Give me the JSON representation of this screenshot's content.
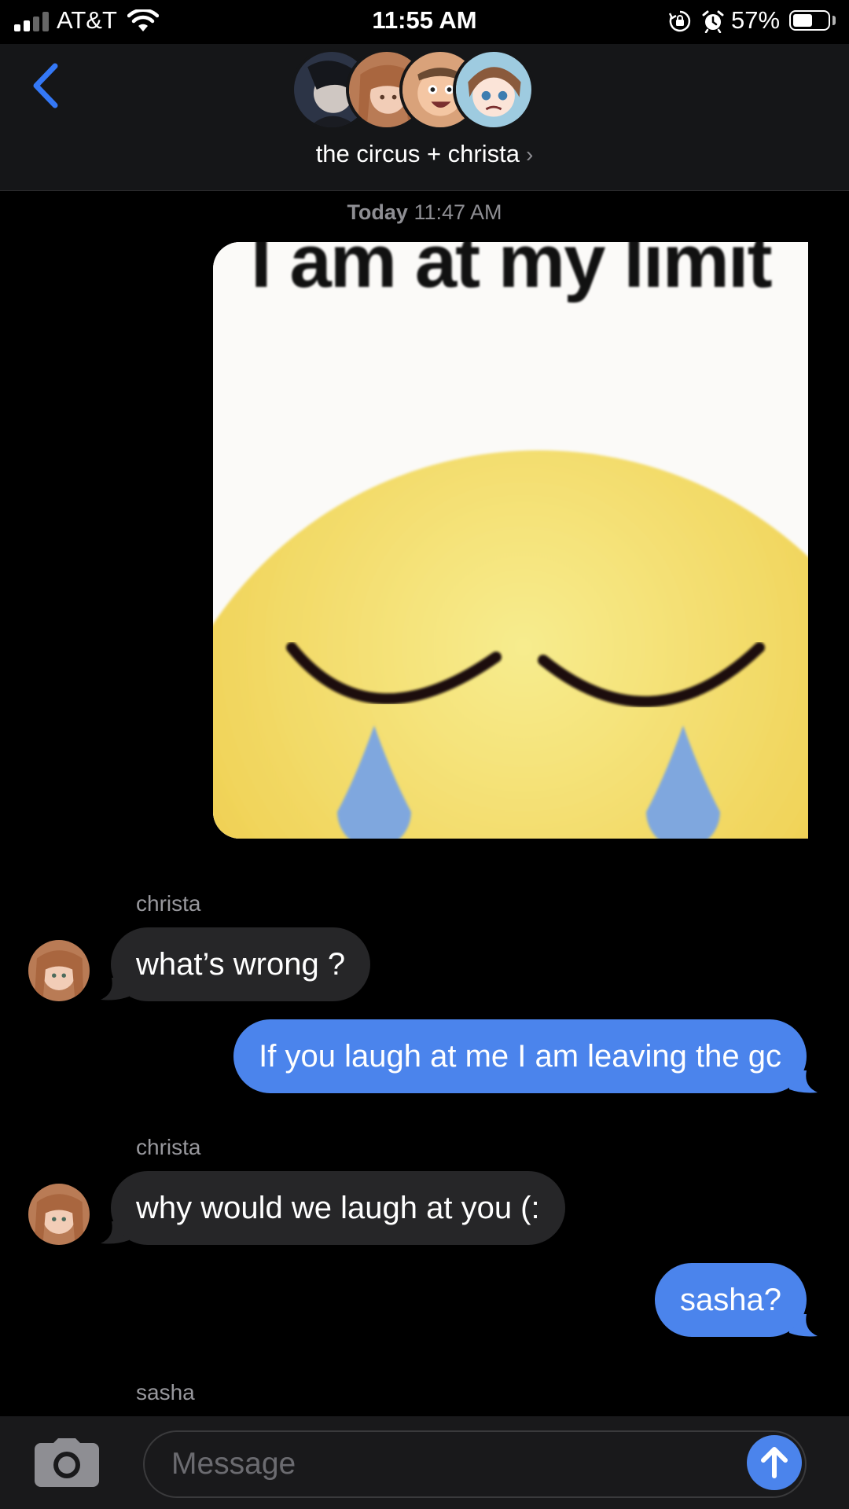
{
  "status_bar": {
    "carrier": "AT&T",
    "time": "11:55 AM",
    "battery_percent": "57%",
    "battery_level": 0.57,
    "signal_bars_filled": 2,
    "icons": [
      "signal-icon",
      "wifi-icon",
      "rotation-lock-icon",
      "alarm-icon",
      "battery-icon"
    ]
  },
  "header": {
    "title": "the circus + christa",
    "chevron": "›",
    "member_avatars": 4,
    "back_icon": "chevron-left-icon"
  },
  "conversation": {
    "timestamp_day": "Today",
    "timestamp_time": "11:47 AM",
    "image_message": {
      "caption_text": "I am at my limit"
    },
    "messages": [
      {
        "sender": "christa",
        "direction": "incoming",
        "text": "what’s wrong ?"
      },
      {
        "direction": "outgoing",
        "text": "If you laugh at me I am leaving the gc"
      },
      {
        "sender": "christa",
        "direction": "incoming",
        "text": "why would we laugh at you (:"
      },
      {
        "direction": "outgoing",
        "text": "sasha?"
      },
      {
        "sender": "sasha",
        "direction": "incoming",
        "text": ""
      }
    ]
  },
  "compose": {
    "placeholder": "Message",
    "camera_icon": "camera-icon",
    "send_icon": "arrow-up-icon"
  },
  "colors": {
    "background": "#000000",
    "header_bg": "#151618",
    "outgoing_bubble": "#4b84ec",
    "incoming_bubble": "#262628",
    "accent": "#3478f6",
    "secondary_text": "#8e8e93"
  }
}
